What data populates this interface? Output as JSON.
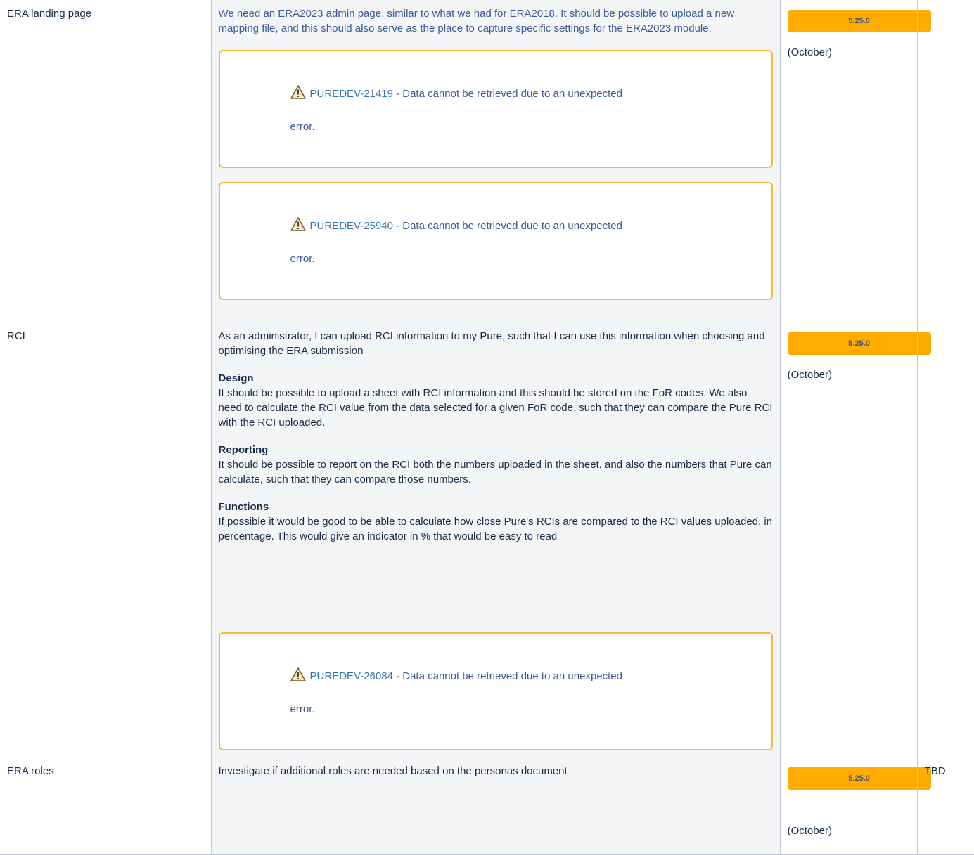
{
  "rows": [
    {
      "feature": "ERA landing page",
      "description": "We need an ERA2023 admin page, similar to what we had for ERA2018. It should be possible to upload a new mapping file, and this should also serve as the place to capture specific settings for the ERA2023 module.",
      "jira": [
        {
          "key": "PUREDEV-21419",
          "message": " - Data cannot be retrieved due to an unexpected",
          "message_cont": "error."
        },
        {
          "key": "PUREDEV-25940",
          "message": " - Data cannot be retrieved due to an unexpected",
          "message_cont": "error."
        }
      ],
      "release": "5.25.0",
      "month": "(October)",
      "status": ""
    },
    {
      "feature": "RCI",
      "intro": "As an administrator, I can upload RCI information to my Pure, such that I can use this information when choosing and optimising the ERA submission",
      "sections": [
        {
          "heading": "Design",
          "text": "It should be possible to upload a sheet with RCI information and this should be stored on the FoR codes. We also need to calculate the RCI value from the data selected for a given FoR code, such that they can compare the Pure RCI with the RCI uploaded."
        },
        {
          "heading": "Reporting",
          "text": "It should be possible to report on the RCI both the numbers uploaded in the sheet, and also the numbers that Pure can calculate, such that they can compare those numbers."
        },
        {
          "heading": "Functions",
          "text": "If possible it would be good to be able to calculate how close Pure's RCIs are compared to the  RCI values uploaded, in percentage. This would give an indicator in % that would be easy to read"
        }
      ],
      "jira": [
        {
          "key": "PUREDEV-26084",
          "message": " - Data cannot be retrieved due to an unexpected",
          "message_cont": "error."
        }
      ],
      "release": "5.25.0",
      "month": "(October)",
      "status": ""
    },
    {
      "feature": "ERA roles",
      "description": "Investigate if additional roles are needed based on the personas document",
      "release": "5.25.0",
      "month": "(October)",
      "status": "TBD"
    }
  ],
  "colors": {
    "lozenge": "#ffab00",
    "jira_border": "#f6b935",
    "jira_link": "#3572b0",
    "description_cell": "#f4f5f7"
  },
  "icons": {
    "warning": "warning-icon"
  }
}
